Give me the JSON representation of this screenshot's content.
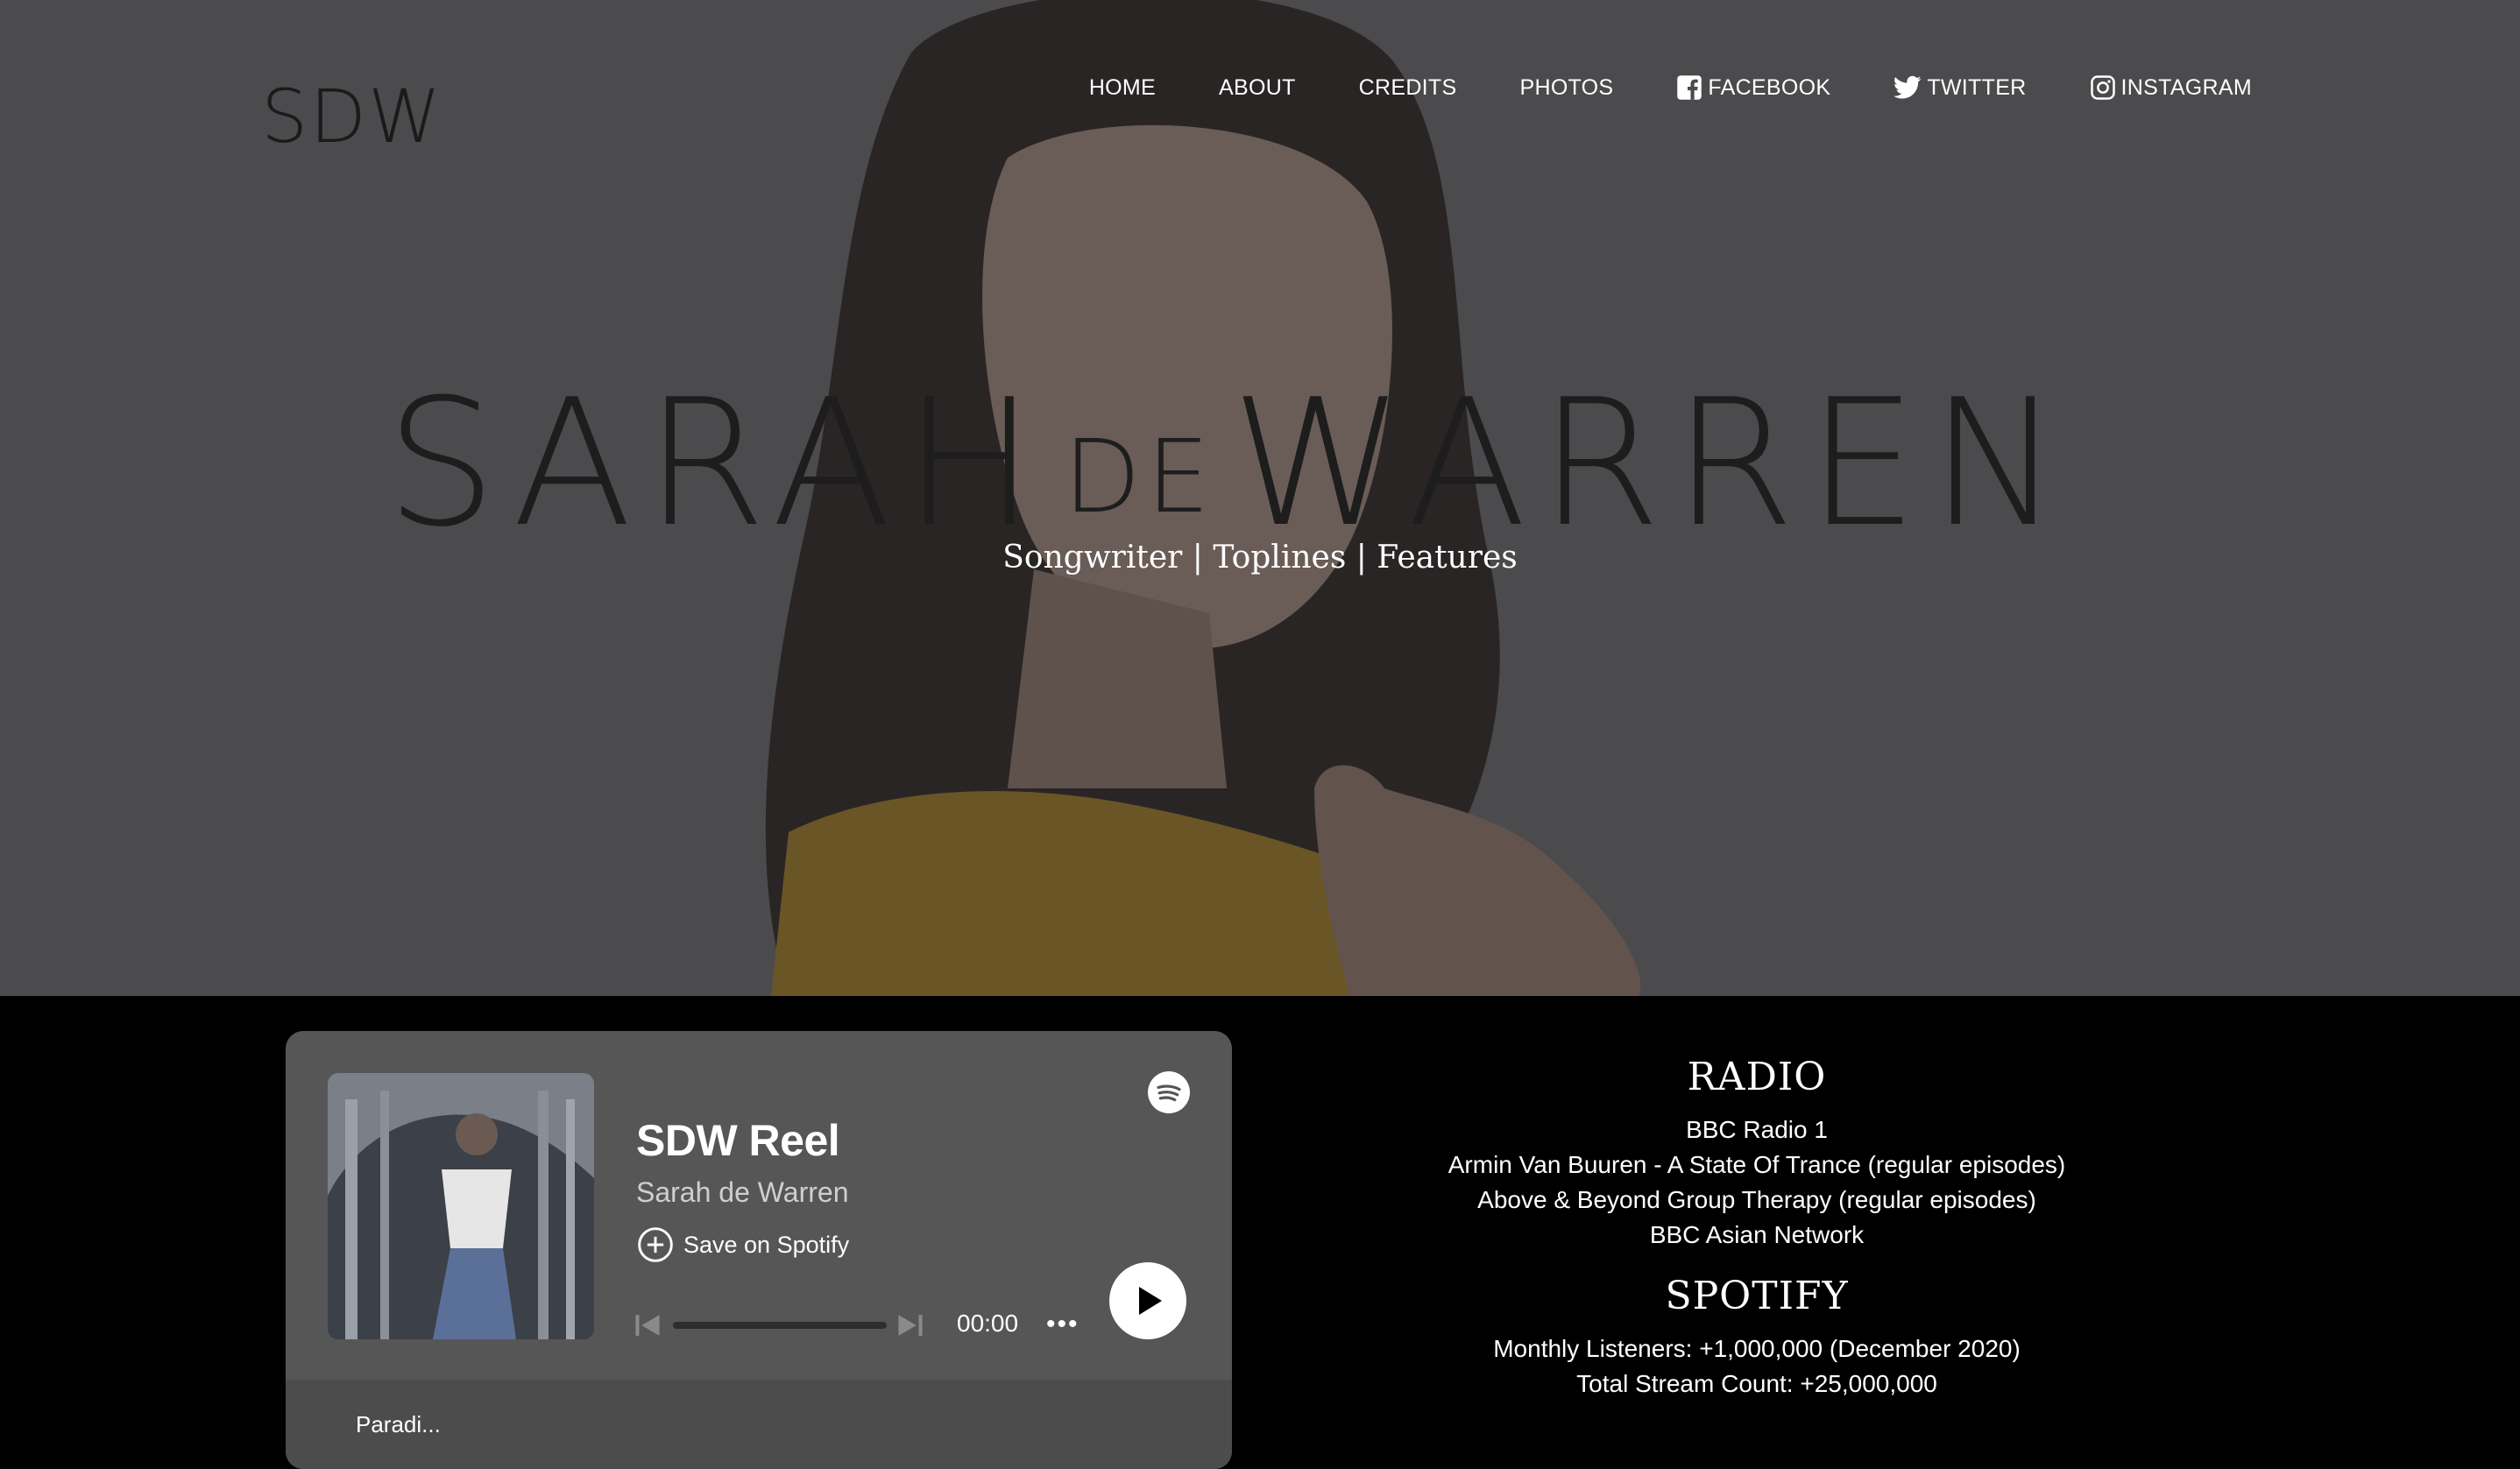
{
  "logo": "SDW",
  "nav": {
    "home": "HOME",
    "about": "ABOUT",
    "credits": "CREDITS",
    "photos": "PHOTOS",
    "facebook": "FACEBOOK",
    "twitter": "TWITTER",
    "instagram": "INSTAGRAM"
  },
  "hero": {
    "title_first": "SARAH",
    "title_de": "DE",
    "title_last": "WARREN",
    "subtitle": "Songwriter | Toplines | Features"
  },
  "player": {
    "title": "SDW Reel",
    "artist": "Sarah de Warren",
    "save_label": "Save on Spotify",
    "time": "00:00",
    "more": "•••",
    "bottom_label": "Paradi...",
    "progress": 0
  },
  "radio": {
    "heading": "RADIO",
    "items": [
      "BBC Radio 1",
      "Armin Van Buuren - A State Of Trance (regular episodes)",
      "Above & Beyond Group Therapy (regular episodes)",
      "BBC Asian Network"
    ]
  },
  "spotify": {
    "heading": "SPOTIFY",
    "items": [
      "Monthly Listeners: +1,000,000 (December 2020)",
      "Total Stream Count: +25,000,000"
    ]
  },
  "colors": {
    "hero_overlay": "#4a4a4c",
    "title_dark": "#1d1d1e",
    "player_bg": "#565656",
    "page_bg": "#000000"
  }
}
